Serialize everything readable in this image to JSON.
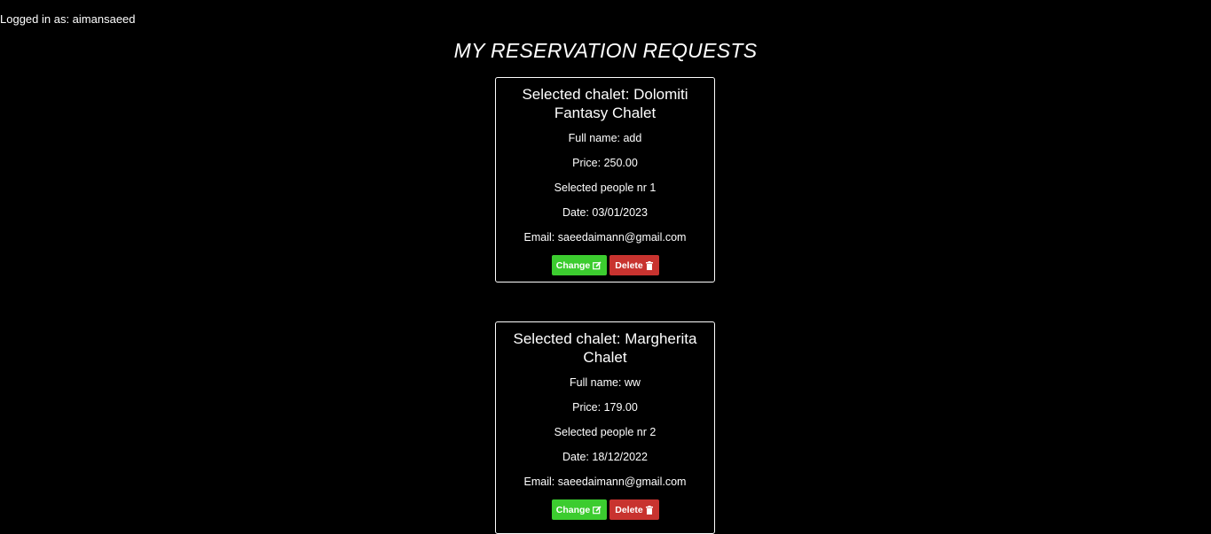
{
  "header": {
    "logged_in_text": "Logged in as: aimansaeed"
  },
  "page_title": "MY RESERVATION REQUESTS",
  "reservations": [
    {
      "chalet": "Selected chalet: Dolomiti Fantasy Chalet",
      "full_name": "Full name: add",
      "price": "Price: 250.00",
      "people": "Selected people nr 1",
      "date": "Date: 03/01/2023",
      "email": "Email: saeedaimann@gmail.com",
      "change_label": "Change",
      "delete_label": "Delete"
    },
    {
      "chalet": "Selected chalet: Margherita Chalet",
      "full_name": "Full name: ww",
      "price": "Price: 179.00",
      "people": "Selected people nr 2",
      "date": "Date: 18/12/2022",
      "email": "Email: saeedaimann@gmail.com",
      "change_label": "Change",
      "delete_label": "Delete"
    }
  ],
  "icons": {
    "change": "edit-icon",
    "delete": "trash-icon"
  },
  "colors": {
    "background": "#000000",
    "text": "#ffffff",
    "change_button": "#3ccc2f",
    "delete_button": "#c8332f"
  }
}
